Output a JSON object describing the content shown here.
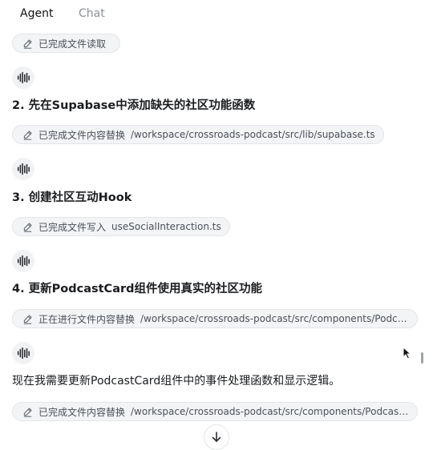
{
  "tabs": [
    {
      "label": "Agent",
      "active": true
    },
    {
      "label": "Chat",
      "active": false
    }
  ],
  "feed": {
    "items": [
      {
        "kind": "tool",
        "status": "已完成文件读取",
        "path": ""
      },
      {
        "kind": "heading",
        "text": "2. 先在Supabase中添加缺失的社区功能函数"
      },
      {
        "kind": "tool",
        "status": "已完成文件内容替换",
        "path": "/workspace/crossroads-podcast/src/lib/supabase.ts"
      },
      {
        "kind": "heading",
        "text": "3. 创建社区互动Hook"
      },
      {
        "kind": "tool",
        "status": "已完成文件写入",
        "path": "useSocialInteraction.ts"
      },
      {
        "kind": "heading",
        "text": "4. 更新PodcastCard组件使用真实的社区功能"
      },
      {
        "kind": "tool",
        "status": "正在进行文件内容替换",
        "path": "/workspace/crossroads-podcast/src/components/PodcastCard.tsx"
      },
      {
        "kind": "text",
        "text": "现在我需要更新PodcastCard组件中的事件处理函数和显示逻辑。"
      },
      {
        "kind": "tool",
        "status": "已完成文件内容替换",
        "path": "/workspace/crossroads-podcast/src/components/PodcastCard.tsx"
      }
    ]
  },
  "icons": {
    "tool": "pencil-icon",
    "avatar": "waveform-icon",
    "scroll": "arrow-down-icon"
  },
  "colors": {
    "pill_bg": "#f3f4f6",
    "pill_border": "#e3e5e8",
    "text": "#1a1c1f",
    "muted": "#8a8f98"
  }
}
